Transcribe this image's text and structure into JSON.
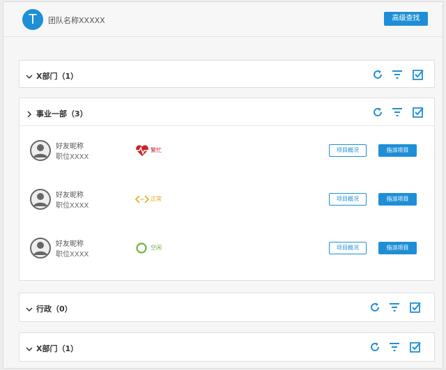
{
  "header": {
    "logo_letter": "T",
    "team_name": "团队名称XXXXX",
    "advanced_search_label": "高级查找"
  },
  "departments": [
    {
      "title": "X部门（1）",
      "expanded": false
    },
    {
      "title": "事业一部（3）",
      "expanded": true,
      "members": [
        {
          "name": "好友昵称",
          "position": "职位XXXX",
          "status": "繁忙",
          "status_icon": "heartbeat-icon",
          "status_color": "#cc2229",
          "overview_label": "项目概况",
          "assign_label": "指派项目"
        },
        {
          "name": "好友昵称",
          "position": "职位XXXX",
          "status": "正常",
          "status_icon": "code-arrows-icon",
          "status_color": "#e8a719",
          "overview_label": "项目概况",
          "assign_label": "指派项目"
        },
        {
          "name": "好友昵称",
          "position": "职位XXXX",
          "status": "空闲",
          "status_icon": "ring-icon",
          "status_color": "#6db33f",
          "overview_label": "项目概况",
          "assign_label": "指派项目"
        }
      ]
    },
    {
      "title": "行政（0）",
      "expanded": false
    },
    {
      "title": "X部门（1）",
      "expanded": false
    }
  ],
  "colors": {
    "accent": "#1e8fd6"
  }
}
